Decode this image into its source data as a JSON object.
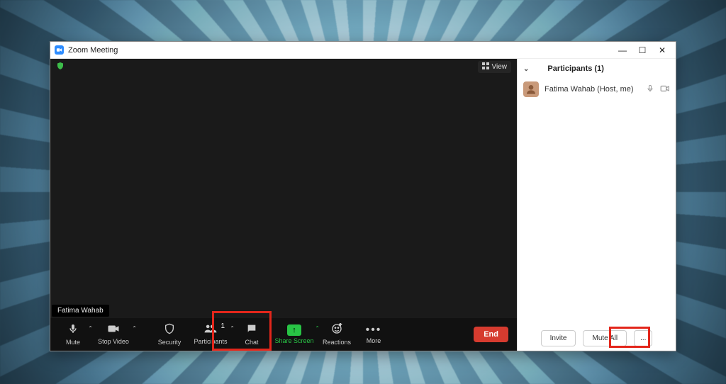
{
  "window": {
    "title": "Zoom Meeting"
  },
  "video": {
    "view_label": "View",
    "participant_name_overlay": "Fatima Wahab"
  },
  "toolbar": {
    "mute": "Mute",
    "stop_video": "Stop Video",
    "security": "Security",
    "participants": "Participants",
    "participants_count": "1",
    "chat": "Chat",
    "share": "Share Screen",
    "reactions": "Reactions",
    "more": "More",
    "end": "End"
  },
  "panel": {
    "header": "Participants (1)",
    "rows": [
      {
        "name": "Fatima Wahab (Host, me)"
      }
    ],
    "invite": "Invite",
    "mute_all": "Mute All",
    "more": "..."
  }
}
